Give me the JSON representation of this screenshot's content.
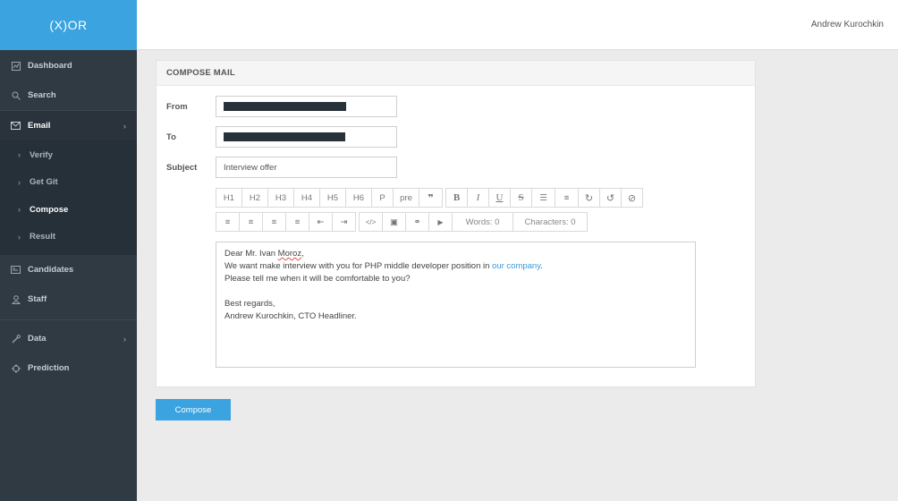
{
  "brand": "(X)OR",
  "header": {
    "user_name": "Andrew Kurochkin"
  },
  "sidebar": {
    "items": [
      {
        "label": "Dashboard",
        "icon": "dashboard-icon"
      },
      {
        "label": "Search",
        "icon": "search-icon"
      },
      {
        "label": "Email",
        "icon": "envelope-icon",
        "chevron": "›"
      },
      {
        "label": "Candidates",
        "icon": "id-card-icon"
      },
      {
        "label": "Staff",
        "icon": "user-icon"
      },
      {
        "label": "Data",
        "icon": "tool-icon",
        "chevron": "›"
      },
      {
        "label": "Prediction",
        "icon": "crosshair-icon"
      }
    ],
    "email_sub": [
      {
        "label": "Verify"
      },
      {
        "label": "Get Git"
      },
      {
        "label": "Compose"
      },
      {
        "label": "Result"
      }
    ],
    "sub_chevron": "›"
  },
  "panel": {
    "title": "COMPOSE MAIL",
    "from_label": "From",
    "to_label": "To",
    "subject_label": "Subject",
    "subject_value": "Interview offer"
  },
  "toolbar": {
    "row1": [
      "H1",
      "H2",
      "H3",
      "H4",
      "H5",
      "H6",
      "P",
      "pre",
      "❞"
    ],
    "row1b": [
      "B",
      "I",
      "U",
      "S",
      "☰",
      "≡",
      "↻",
      "↺",
      "⊘"
    ],
    "row2": [
      "≡",
      "≡",
      "≡",
      "≡",
      "⇤",
      "⇥"
    ],
    "row2b": [
      "</>",
      "▣",
      "⚭",
      "▶"
    ],
    "words": "Words: 0",
    "characters": "Characters: 0"
  },
  "editor": {
    "line1_pre": "Dear Mr. Ivan ",
    "line1_name": "Moroz",
    "line1_post": ",",
    "line2_pre": "We want make interview with you for PHP middle developer position in ",
    "line2_link": "our company",
    "line2_post": ".",
    "line3": "Please tell me when it will be comfortable to you?",
    "line5": "Best regards,",
    "line6": "Andrew Kurochkin, CTO Headliner."
  },
  "compose_button": "Compose"
}
